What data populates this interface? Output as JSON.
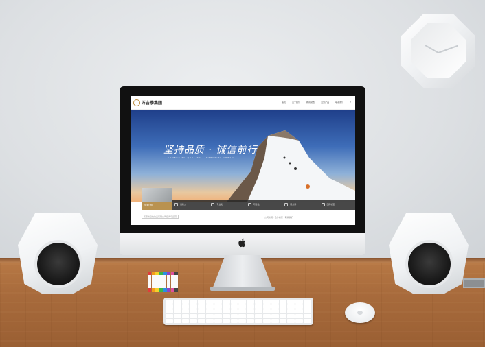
{
  "site": {
    "logo_text": "万吉季集团",
    "nav": [
      "首页",
      "关于我们",
      "新闻动态",
      "业务产品",
      "联系我们",
      "Ξ"
    ],
    "headline": "坚持品质 · 诚信前行",
    "subline": "ADHERE TO QUALITY · INTEGRITY AHEAD",
    "thumb_label": "企业介绍",
    "bar_items": [
      "创新力",
      "专业化",
      "可靠性",
      "服务好",
      "国际视野"
    ],
    "search_placeholder": "万家新日化妆品有限公司招商与运营",
    "news_text": "公司新闻 · 合作商家 · 联系我们"
  },
  "marker_colors": [
    "#e23b3b",
    "#f59a1c",
    "#f3d22a",
    "#3bb54a",
    "#2c8de0",
    "#8a44c9",
    "#e04f9b",
    "#444444"
  ],
  "colors": {
    "accent_gold": "#b99250",
    "hero_top": "#1f3f8a",
    "hero_bottom": "#f0b27a"
  }
}
